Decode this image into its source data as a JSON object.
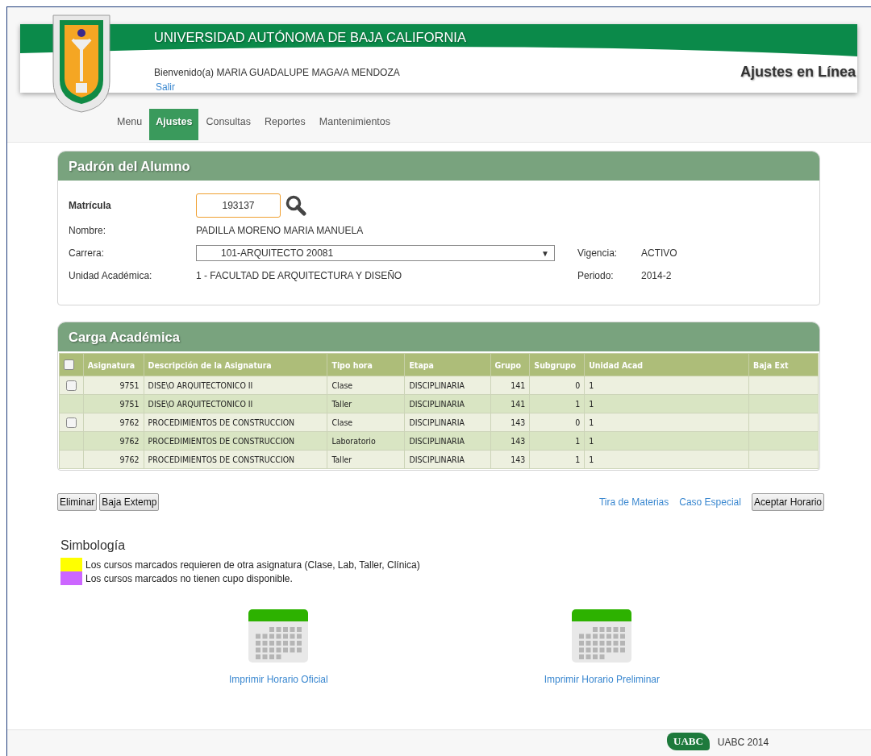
{
  "header": {
    "title": "UNIVERSIDAD AUTÓNOMA DE BAJA CALIFORNIA",
    "welcome": "Bienvenido(a) MARIA GUADALUPE MAGA/A MENDOZA",
    "logout": "Salir",
    "app_name": "Ajustes en Línea"
  },
  "nav": [
    {
      "label": "Menu",
      "selected": false
    },
    {
      "label": "Ajustes",
      "selected": true
    },
    {
      "label": "Consultas",
      "selected": false
    },
    {
      "label": "Reportes",
      "selected": false
    },
    {
      "label": "Mantenimientos",
      "selected": false
    }
  ],
  "student_panel": {
    "title": "Padrón del Alumno",
    "matricula_label": "Matrícula",
    "matricula_value": "193137",
    "name_label": "Nombre:",
    "name_value": "PADILLA MORENO MARIA MANUELA",
    "career_label": "Carrera:",
    "career_value": "101-ARQUITECTO 20081",
    "career_caret": "▼",
    "vigencia_label": "Vigencia:",
    "vigencia_value": "ACTIVO",
    "unit_label": "Unidad Académica:",
    "unit_value": "1 - FACULTAD DE ARQUITECTURA Y DISEÑO",
    "period_label": "Periodo:",
    "period_value": "2014-2"
  },
  "load_panel": {
    "title": "Carga Académica",
    "select_all_checked": false,
    "columns": [
      "Asignatura",
      "Descripción de la Asignatura",
      "Tipo hora",
      "Etapa",
      "Grupo",
      "Subgrupo",
      "Unidad Acad",
      "Baja Ext"
    ],
    "rows": [
      {
        "kind": "checkbox",
        "checked": false,
        "cells": [
          "9751",
          "DISE\\O ARQUITECTONICO II",
          "Clase",
          "DISCIPLINARIA",
          "141",
          "0",
          "1"
        ]
      },
      {
        "kind": "plain",
        "cells": [
          "9751",
          "DISE\\O ARQUITECTONICO II",
          "Taller",
          "DISCIPLINARIA",
          "141",
          "1",
          "1"
        ]
      },
      {
        "kind": "checkbox",
        "checked": false,
        "cells": [
          "9762",
          "PROCEDIMIENTOS DE CONSTRUCCION",
          "Clase",
          "DISCIPLINARIA",
          "143",
          "0",
          "1"
        ]
      },
      {
        "kind": "plain",
        "cells": [
          "9762",
          "PROCEDIMIENTOS DE CONSTRUCCION",
          "Laboratorio",
          "DISCIPLINARIA",
          "143",
          "1",
          "1"
        ]
      },
      {
        "kind": "plain",
        "cells": [
          "9762",
          "PROCEDIMIENTOS DE CONSTRUCCION",
          "Taller",
          "DISCIPLINARIA",
          "143",
          "1",
          "1"
        ]
      }
    ]
  },
  "left_buttons": [
    "Eliminar",
    "Baja Extemp"
  ],
  "right_links": [
    "Tira de Materias",
    "Caso Especial"
  ],
  "right_button": "Aceptar Horario",
  "legend": {
    "title": "Simbología",
    "items": [
      {
        "color": "#ffff00",
        "text": "Los cursos marcados requieren de otra asignatura (Clase, Lab, Taller, Clínica)"
      },
      {
        "color": "#cc66ff",
        "text": "Los cursos marcados no tienen cupo disponible."
      }
    ]
  },
  "print_links": [
    "Imprimir Horario Oficial",
    "Imprimir Horario Preliminar"
  ],
  "footer": {
    "logo_text": "UABC",
    "text": "UABC 2014"
  }
}
